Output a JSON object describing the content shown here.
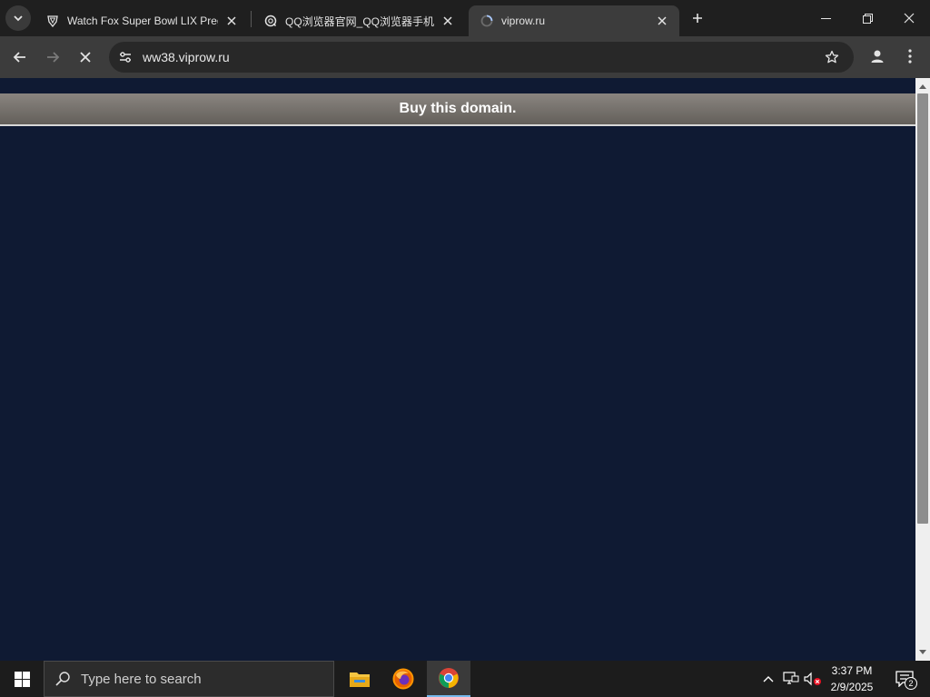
{
  "browser": {
    "tabs": [
      {
        "title": "Watch Fox Super Bowl LIX Preg",
        "favicon": "shield-icon",
        "active": false
      },
      {
        "title": "QQ浏览器官网_QQ浏览器手机",
        "favicon": "qq-browser-icon",
        "active": false
      },
      {
        "title": "viprow.ru",
        "favicon": "loading-spinner-icon",
        "active": true
      }
    ],
    "address_bar": {
      "url": "ww38.viprow.ru"
    },
    "colors": {
      "tab_bar": "#1f1f1f",
      "toolbar": "#3c3c3c",
      "omnibox": "#282828"
    }
  },
  "page": {
    "domain_banner": "Buy this domain.",
    "colors": {
      "background": "#0f1a33",
      "banner_top": "#8a8580",
      "banner_bottom": "#635f5a"
    }
  },
  "taskbar": {
    "search_placeholder": "Type here to search",
    "apps": [
      "file-explorer-icon",
      "firefox-icon",
      "chrome-icon"
    ],
    "clock": {
      "time": "3:37 PM",
      "date": "2/9/2025"
    },
    "notification_count": "2"
  }
}
